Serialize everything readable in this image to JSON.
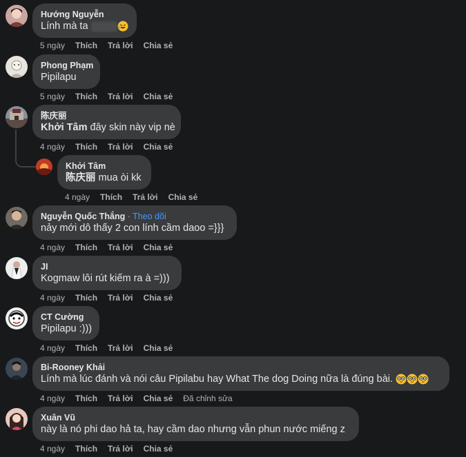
{
  "actions": {
    "like": "Thích",
    "reply": "Trả lời",
    "share": "Chia sẻ",
    "edited": "Đã chỉnh sửa"
  },
  "comments": [
    {
      "author": "Hướng Nguyễn",
      "text": "Lính mà ta",
      "time": "5 ngày"
    },
    {
      "author": "Phong Phạm",
      "text": "Pipilapu",
      "time": "5 ngày"
    },
    {
      "author": "陈庆丽",
      "mention": "Khởi Tâm",
      "text": "đây skin này vip nè",
      "time": "4 ngày"
    },
    {
      "author": "Khởi Tâm",
      "mention": "陈庆丽",
      "text": "mua òi kk",
      "time": "4 ngày"
    },
    {
      "author": "Nguyễn Quốc Thắng",
      "follow": "Theo dõi",
      "text": "nảy mới dô thấy 2 con lính cầm daoo =}}}",
      "time": "4 ngày"
    },
    {
      "author": "JI",
      "text": "Kogmaw lôi rút kiếm ra à =)))",
      "time": "4 ngày"
    },
    {
      "author": "CT Cường",
      "text": "Pipilapu :)))",
      "time": "4 ngày"
    },
    {
      "author": "Bi-Rooney Khải",
      "text": "Lính mà lúc đánh và nói câu Pipilabu hay What The dog Doing nữa là đúng bài.",
      "time": "4 ngày"
    },
    {
      "author": "Xuân Vũ",
      "text": "này là nó phi dao hả ta, hay cầm dao nhưng vẫn phun nước miếng z",
      "time": "4 ngày"
    }
  ]
}
